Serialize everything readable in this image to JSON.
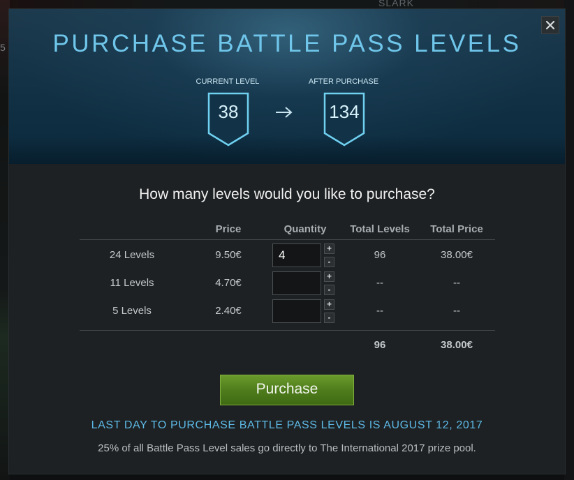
{
  "background": {
    "hero_name": "SLARK",
    "side_number": "5"
  },
  "dialog": {
    "title": "PURCHASE BATTLE PASS LEVELS",
    "close_icon": "close-icon",
    "current_level_label": "CURRENT LEVEL",
    "current_level": "38",
    "after_purchase_label": "AFTER PURCHASE",
    "after_purchase_level": "134",
    "arrow_icon": "arrow-right-icon",
    "question": "How many levels would you like to purchase?",
    "table": {
      "headers": [
        "Price",
        "Quantity",
        "Total Levels",
        "Total Price"
      ],
      "rows": [
        {
          "name": "24 Levels",
          "price": "9.50€",
          "quantity": "4",
          "total_levels": "96",
          "total_price": "38.00€"
        },
        {
          "name": "11 Levels",
          "price": "4.70€",
          "quantity": "",
          "total_levels": "--",
          "total_price": "--"
        },
        {
          "name": "5 Levels",
          "price": "2.40€",
          "quantity": "",
          "total_levels": "--",
          "total_price": "--"
        }
      ],
      "totals": {
        "total_levels": "96",
        "total_price": "38.00€"
      },
      "increment_symbol": "+",
      "decrement_symbol": "-"
    },
    "purchase_button": "Purchase",
    "deadline": "LAST DAY TO PURCHASE BATTLE PASS LEVELS IS AUGUST 12, 2017",
    "footnote": "25% of all Battle Pass Level sales go directly to The International 2017 prize pool."
  },
  "colors": {
    "title": "#6fc6ea",
    "deadline": "#5db9e6",
    "purchase_button": "#4f7d1c",
    "dialog_bg": "#1e2123"
  }
}
